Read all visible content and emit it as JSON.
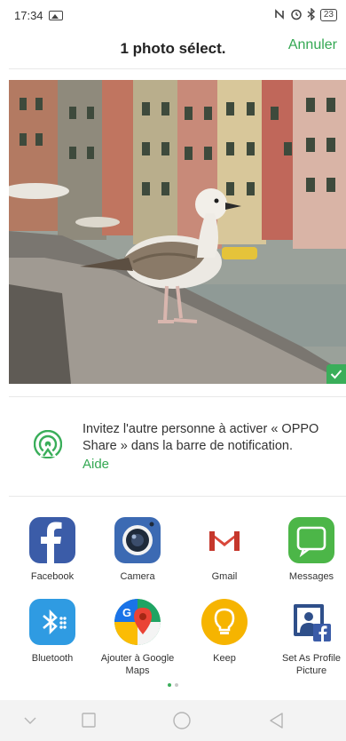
{
  "status_bar": {
    "time": "17:34",
    "battery": "23",
    "icons": [
      "image-notification-icon",
      "nfc-icon",
      "alarm-icon",
      "bluetooth-icon",
      "battery-icon"
    ]
  },
  "header": {
    "title": "1 photo sélect.",
    "cancel_label": "Annuler"
  },
  "photo": {
    "selected": true,
    "description_icon": "selected-check-icon"
  },
  "share_info": {
    "icon": "oppo-share-icon",
    "text": "Invitez l'autre personne à activer « OPPO Share » dans la barre de notification.",
    "help_label": "Aide"
  },
  "apps": [
    {
      "label": "Facebook",
      "icon": "facebook-icon"
    },
    {
      "label": "Camera",
      "icon": "camera-icon"
    },
    {
      "label": "Gmail",
      "icon": "gmail-icon"
    },
    {
      "label": "Messages",
      "icon": "messages-icon"
    },
    {
      "label": "Bluetooth",
      "icon": "bluetooth-icon"
    },
    {
      "label": "Ajouter à Google Maps",
      "icon": "google-maps-icon"
    },
    {
      "label": "Keep",
      "icon": "keep-icon"
    },
    {
      "label": "Set As Profile Picture",
      "icon": "profile-picture-icon"
    }
  ],
  "pagination": {
    "current_page": 1,
    "total_pages": 2
  },
  "navbar": {
    "icons": [
      "back-chevron-icon",
      "recents-icon",
      "home-icon",
      "back-triangle-icon"
    ]
  },
  "colors": {
    "accent": "#34a853",
    "active_dot": "#3aae5a",
    "inactive_dot": "#c8c8c8"
  }
}
